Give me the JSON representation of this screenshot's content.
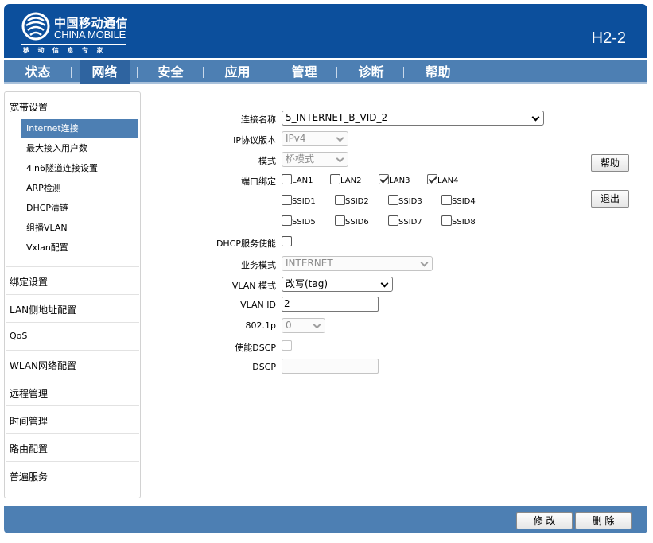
{
  "header": {
    "logo_cn": "中国移动通信",
    "logo_en": "CHINA MOBILE",
    "logo_slogan": "移动信息专家",
    "model": "H2-2"
  },
  "nav": {
    "items": [
      "状态",
      "网络",
      "安全",
      "应用",
      "管理",
      "诊断",
      "帮助"
    ],
    "active": "网络"
  },
  "sidebar": {
    "group_broadband": "宽带设置",
    "subitems": [
      "Internet连接",
      "最大接入用户数",
      "4in6隧道连接设置",
      "ARP检测",
      "DHCP清链",
      "组播VLAN",
      "Vxlan配置"
    ],
    "active_subitem": "Internet连接",
    "groups": [
      "绑定设置",
      "LAN侧地址配置",
      "QoS",
      "WLAN网络配置",
      "远程管理",
      "时间管理",
      "路由配置",
      "普遍服务"
    ]
  },
  "form": {
    "conn_name_label": "连接名称",
    "conn_name_value": "5_INTERNET_B_VID_2",
    "ip_version_label": "IP协议版本",
    "ip_version_value": "IPv4",
    "mode_label": "模式",
    "mode_value": "桥模式",
    "port_bind_label": "端口绑定",
    "ports": [
      {
        "label": "LAN1",
        "checked": false
      },
      {
        "label": "LAN2",
        "checked": false
      },
      {
        "label": "LAN3",
        "checked": true
      },
      {
        "label": "LAN4",
        "checked": true
      }
    ],
    "ssids_row1": [
      {
        "label": "SSID1",
        "checked": false
      },
      {
        "label": "SSID2",
        "checked": false
      },
      {
        "label": "SSID3",
        "checked": false
      },
      {
        "label": "SSID4",
        "checked": false
      }
    ],
    "ssids_row2": [
      {
        "label": "SSID5",
        "checked": false
      },
      {
        "label": "SSID6",
        "checked": false
      },
      {
        "label": "SSID7",
        "checked": false
      },
      {
        "label": "SSID8",
        "checked": false
      }
    ],
    "dhcp_label": "DHCP服务使能",
    "dhcp_checked": false,
    "service_mode_label": "业务模式",
    "service_mode_value": "INTERNET",
    "vlan_mode_label": "VLAN 模式",
    "vlan_mode_value": "改写(tag)",
    "vlan_id_label": "VLAN ID",
    "vlan_id_value": "2",
    "p8021_label": "802.1p",
    "p8021_value": "0",
    "dscp_enable_label": "使能DSCP",
    "dscp_enable_checked": false,
    "dscp_label": "DSCP",
    "dscp_value": ""
  },
  "side_buttons": {
    "help": "帮助",
    "exit": "退出"
  },
  "footer": {
    "modify": "修 改",
    "delete": "删 除"
  },
  "colors": {
    "header_bg": "#0c4f9c",
    "nav_bg": "#4d7fb3",
    "nav_active": "#2f64a0",
    "sidebar_active": "#4d7fb3"
  }
}
